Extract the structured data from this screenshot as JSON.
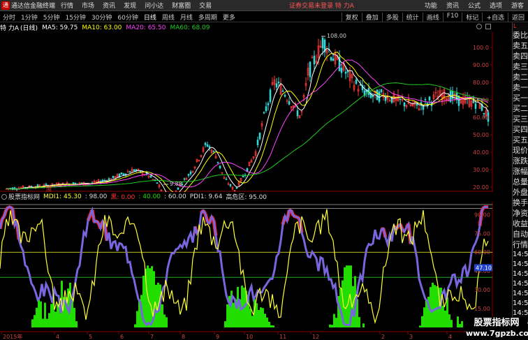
{
  "app": {
    "title": "通达信金融终端",
    "menu": [
      "行情",
      "市场",
      "资讯",
      "发现",
      "问小达",
      "财富圈",
      "交易"
    ],
    "notice": "证券交易未登录",
    "stock_name_top": "特 力A",
    "right_menu": [
      "功能",
      "资讯",
      "公式",
      "选项",
      "游客"
    ]
  },
  "periods": [
    "分时",
    "1分钟",
    "5分钟",
    "15分钟",
    "30分钟",
    "60分钟",
    "日线",
    "周线",
    "月线",
    "多周期",
    "更多"
  ],
  "active_period": "日线",
  "tools": [
    "复权",
    "叠加",
    "多股",
    "统计",
    "画线",
    "F10",
    "标记",
    "+自选",
    "返回"
  ],
  "main_header": {
    "stock": "特 力A",
    "period": "(日线)",
    "ma5": "MA5: 59.75",
    "ma10": "MA10: 63.00",
    "ma20": "MA20: 65.50",
    "ma60": "MA60: 68.09"
  },
  "price_axis": [
    "100.0",
    "90.00",
    "80.00",
    "70.00",
    "60.00",
    "50.00",
    "40.00",
    "30.00",
    "20.00"
  ],
  "high_label": "108.00",
  "low_label": "9.88",
  "indicator_header": {
    "name": "股票指标网",
    "mdi": "MDI1: 45.30",
    "v1": ": 98.00",
    "v2": "黑: 0.00",
    "v3": ": 40.00",
    "v4": ": 60.00",
    "pdi": "PDI1: 9.64",
    "zone": "高危区: 95.00"
  },
  "ind_axis": [
    "90.00",
    "75.00",
    "60.00",
    "45.00",
    "30.00",
    "15.00"
  ],
  "ind_current": "47.10",
  "ding_label": "顶",
  "x_axis": [
    "2015年",
    "4",
    "5",
    "6",
    "7",
    "8",
    "9",
    "10",
    "11",
    "12",
    "2",
    "3",
    "4"
  ],
  "right_panel": {
    "code": "L",
    "rows": [
      "委比",
      "卖五",
      "卖四",
      "卖三",
      "卖二",
      "卖一",
      "买一",
      "买二",
      "买三",
      "买四",
      "买五",
      "现价",
      "涨跌",
      "涨幅",
      "总量",
      "外盘",
      "换手",
      "净资",
      "收益",
      "自动",
      "行情"
    ],
    "times": [
      "14:50",
      "14:50",
      "14:50",
      "14:50",
      "14:50",
      "14:50",
      "14:50",
      "14:50",
      "14:50"
    ]
  },
  "watermark": {
    "line1": "股票指标网",
    "line2": "www.7gpzb.com"
  },
  "colors": {
    "up": "#ff3b3b",
    "down": "#36d7d7",
    "ma5": "#ffffff",
    "ma10": "#ffff00",
    "ma20": "#ff44ff",
    "ma60": "#22cc22",
    "mdi": "#ffff33",
    "pdi": "#7766dd",
    "green_fill": "#22dd00",
    "red_fill": "#ff1a1a"
  }
}
